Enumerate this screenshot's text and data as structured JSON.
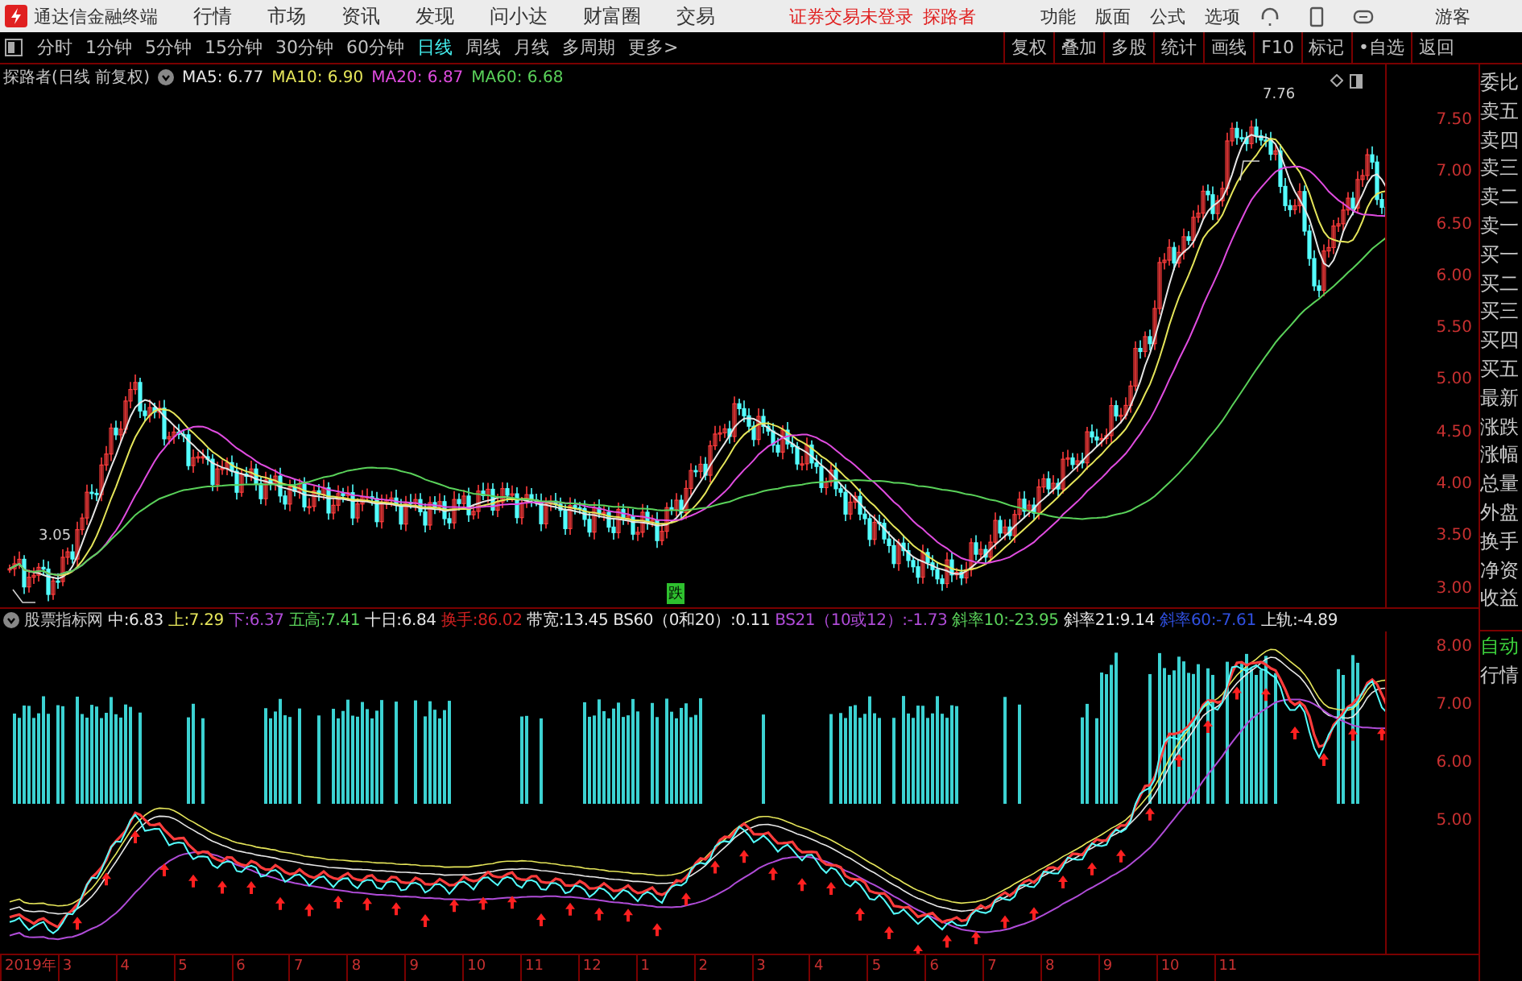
{
  "title_bar": {
    "app_name": "通达信金融终端",
    "menu": [
      "行情",
      "市场",
      "资讯",
      "发现",
      "问小达",
      "财富圈",
      "交易"
    ],
    "login_status": "证券交易未登录",
    "stock_name": "探路者",
    "tools": [
      "功能",
      "版面",
      "公式",
      "选项"
    ],
    "user": "游客"
  },
  "periods": [
    {
      "label": "分时",
      "selected": false
    },
    {
      "label": "1分钟",
      "selected": false
    },
    {
      "label": "5分钟",
      "selected": false
    },
    {
      "label": "15分钟",
      "selected": false
    },
    {
      "label": "30分钟",
      "selected": false
    },
    {
      "label": "60分钟",
      "selected": false
    },
    {
      "label": "日线",
      "selected": true
    },
    {
      "label": "周线",
      "selected": false
    },
    {
      "label": "月线",
      "selected": false
    },
    {
      "label": "多周期",
      "selected": false
    },
    {
      "label": "更多>",
      "selected": false
    }
  ],
  "actions": [
    "复权",
    "叠加",
    "多股",
    "统计",
    "画线",
    "F10",
    "标记",
    "•自选",
    "返回"
  ],
  "price_panel": {
    "title": "探路者(日线 前复权)",
    "ma_legend": [
      {
        "label": "MA5: 6.77",
        "color": "#e6e6e6"
      },
      {
        "label": "MA10: 6.90",
        "color": "#e6e65a"
      },
      {
        "label": "MA20: 6.87",
        "color": "#e04ce0"
      },
      {
        "label": "MA60: 6.68",
        "color": "#5ad25a"
      }
    ],
    "high_marker": "7.76",
    "low_marker": "3.05",
    "signal_label": "跌",
    "y_ticks": [
      "7.50",
      "7.00",
      "6.50",
      "6.00",
      "5.50",
      "5.00",
      "4.50",
      "4.00",
      "3.50",
      "3.00"
    ]
  },
  "indicator_panel": {
    "name": "股票指标网",
    "readouts": [
      {
        "text": "中:6.83",
        "color": "#e6e6e6"
      },
      {
        "text": "上:7.29",
        "color": "#e6e65a"
      },
      {
        "text": "下:6.37",
        "color": "#b04cd8"
      },
      {
        "text": "五高:7.41",
        "color": "#5ad25a"
      },
      {
        "text": "十日:6.84",
        "color": "#e6e6e6"
      },
      {
        "text": "换手:86.02",
        "color": "#d02020"
      },
      {
        "text": "带宽:13.45",
        "color": "#e6e6e6"
      },
      {
        "text": "BS60（0和20）:0.11",
        "color": "#e6e6e6"
      },
      {
        "text": "BS21（10或12）:-1.73",
        "color": "#b04cd8"
      },
      {
        "text": "斜率10:-23.95",
        "color": "#5ad25a"
      },
      {
        "text": "斜率21:9.14",
        "color": "#e6e6e6"
      },
      {
        "text": "斜率60:-7.61",
        "color": "#3050e0"
      },
      {
        "text": "上轨:-4.89",
        "color": "#e6e6e6"
      }
    ],
    "y_ticks": [
      "8.00",
      "7.00",
      "6.00",
      "5.00"
    ]
  },
  "x_axis": [
    "2019年",
    "3",
    "4",
    "5",
    "6",
    "7",
    "8",
    "9",
    "10",
    "11",
    "12",
    "1",
    "2",
    "3",
    "4",
    "5",
    "6",
    "7",
    "8",
    "9",
    "10",
    "11"
  ],
  "quote_fields": [
    "委比",
    "卖五",
    "卖四",
    "卖三",
    "卖二",
    "卖一",
    "买一",
    "买二",
    "买三",
    "买四",
    "买五",
    "最新",
    "涨跌",
    "涨幅",
    "总量",
    "外盘",
    "换手",
    "净资",
    "收益"
  ],
  "lower_side": [
    "自动",
    "行情"
  ]
}
